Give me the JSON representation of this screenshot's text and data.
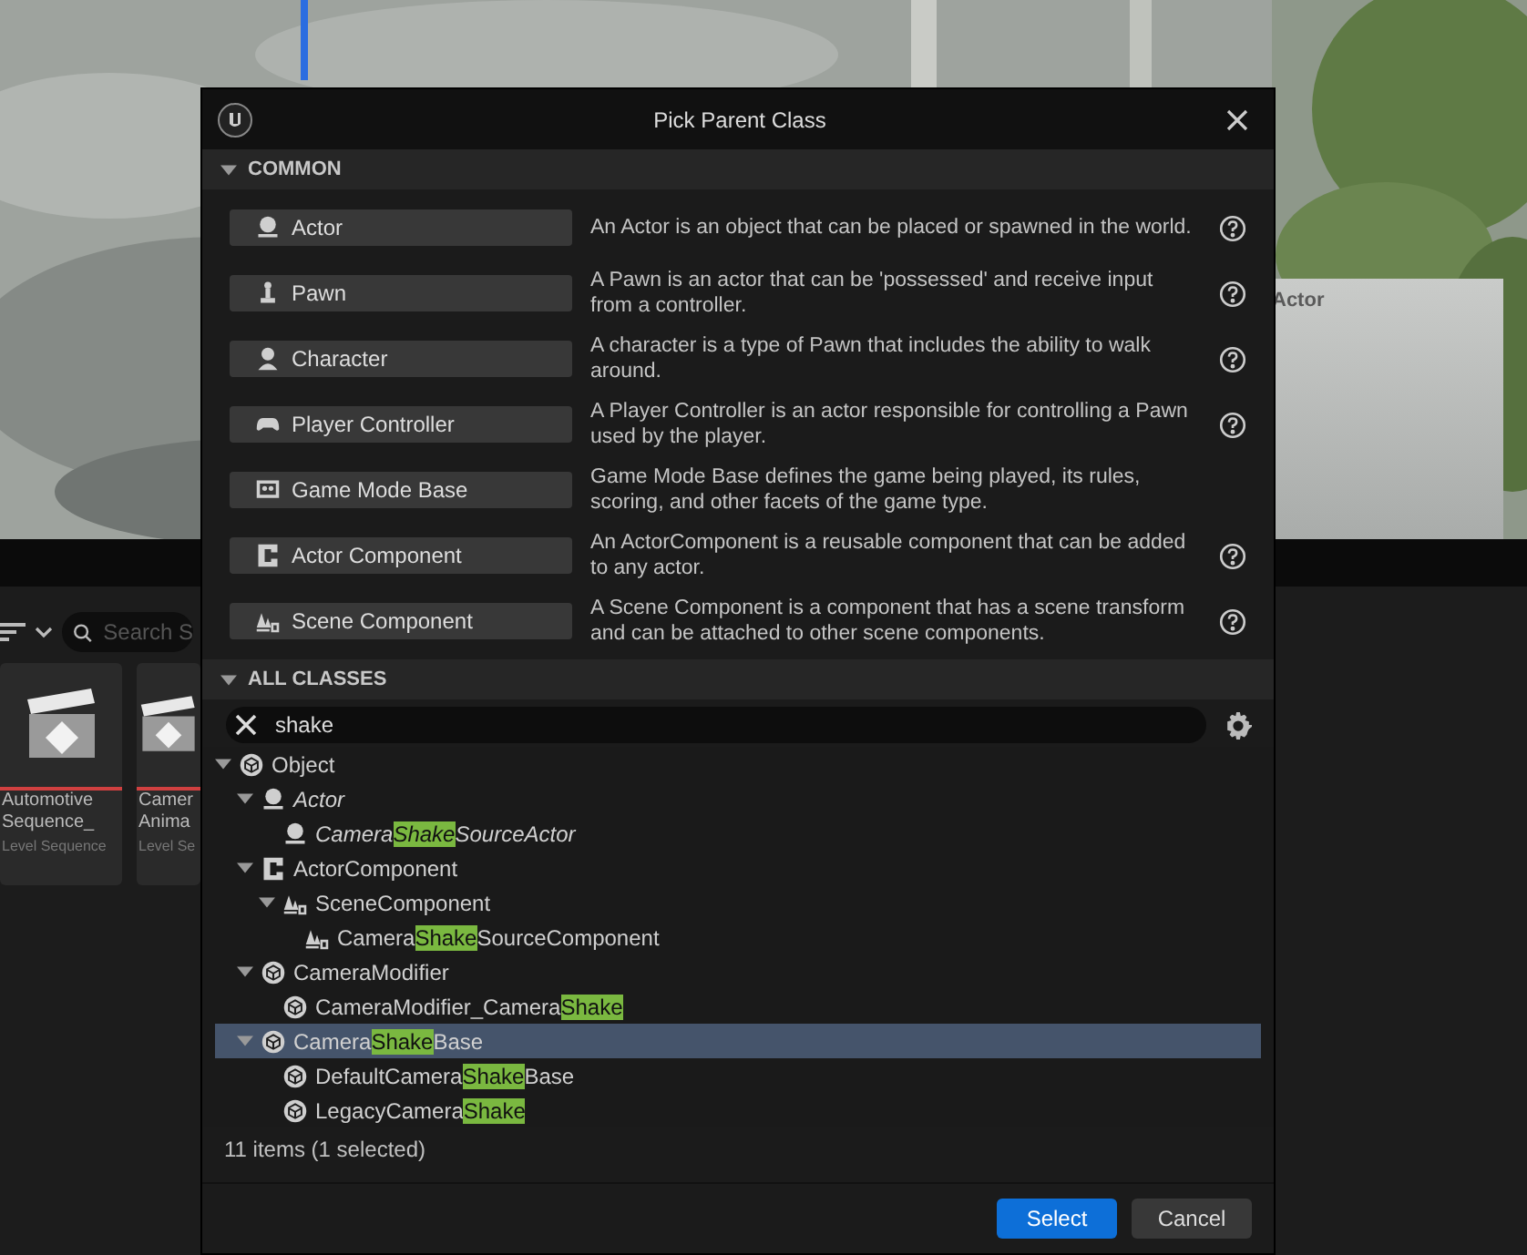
{
  "viewport": {
    "thumbnail_label": "Actor"
  },
  "content_browser": {
    "search": {
      "placeholder": "Search S"
    },
    "assets": [
      {
        "name_lines": [
          "Automotive",
          "Sequence_"
        ],
        "type": "Level Sequence"
      },
      {
        "name_lines": [
          "Camer",
          "Anima"
        ],
        "type": "Level Se"
      }
    ]
  },
  "dialog": {
    "title": "Pick Parent Class",
    "common": {
      "title": "COMMON",
      "expanded": true,
      "rows": [
        {
          "kind": "actor",
          "label": "Actor",
          "description": "An Actor is an object that can be placed or spawned in the world.",
          "help": true
        },
        {
          "kind": "pawn",
          "label": "Pawn",
          "description": "A Pawn is an actor that can be 'possessed' and receive input from a controller.",
          "help": true
        },
        {
          "kind": "character",
          "label": "Character",
          "description": "A character is a type of Pawn that includes the ability to walk around.",
          "help": true
        },
        {
          "kind": "controller",
          "label": "Player Controller",
          "description": "A Player Controller is an actor responsible for controlling a Pawn used by the player.",
          "help": true
        },
        {
          "kind": "gamemode",
          "label": "Game Mode Base",
          "description": "Game Mode Base defines the game being played, its rules, scoring, and other facets of the game type.",
          "help": false
        },
        {
          "kind": "component",
          "label": "Actor Component",
          "description": "An ActorComponent is a reusable component that can be added to any actor.",
          "help": true
        },
        {
          "kind": "scene",
          "label": "Scene Component",
          "description": "A Scene Component is a component that has a scene transform and can be attached to other scene components.",
          "help": true
        }
      ]
    },
    "all_classes": {
      "title": "ALL CLASSES",
      "expanded": true,
      "search": {
        "value": "shake"
      },
      "tree": [
        {
          "kind": "object",
          "italic": false,
          "selected": false,
          "expanded": true,
          "segments": [
            {
              "text": "Object",
              "match": false
            }
          ],
          "children": [
            {
              "kind": "actor",
              "italic": true,
              "selected": false,
              "expanded": true,
              "segments": [
                {
                  "text": "Actor",
                  "match": false
                }
              ],
              "children": [
                {
                  "kind": "actor",
                  "italic": true,
                  "selected": false,
                  "segments": [
                    {
                      "text": "Camera",
                      "match": false
                    },
                    {
                      "text": "Shake",
                      "match": true
                    },
                    {
                      "text": "SourceActor",
                      "match": false
                    }
                  ]
                }
              ]
            },
            {
              "kind": "component",
              "italic": false,
              "selected": false,
              "expanded": true,
              "segments": [
                {
                  "text": "ActorComponent",
                  "match": false
                }
              ],
              "children": [
                {
                  "kind": "scene",
                  "italic": false,
                  "selected": false,
                  "expanded": true,
                  "segments": [
                    {
                      "text": "SceneComponent",
                      "match": false
                    }
                  ],
                  "children": [
                    {
                      "kind": "scene",
                      "italic": false,
                      "selected": false,
                      "segments": [
                        {
                          "text": "Camera",
                          "match": false
                        },
                        {
                          "text": "Shake",
                          "match": true
                        },
                        {
                          "text": "SourceComponent",
                          "match": false
                        }
                      ]
                    }
                  ]
                }
              ]
            },
            {
              "kind": "object",
              "italic": false,
              "selected": false,
              "expanded": true,
              "segments": [
                {
                  "text": "CameraModifier",
                  "match": false
                }
              ],
              "children": [
                {
                  "kind": "object",
                  "italic": false,
                  "selected": false,
                  "segments": [
                    {
                      "text": "CameraModifier_Camera",
                      "match": false
                    },
                    {
                      "text": "Shake",
                      "match": true
                    }
                  ]
                }
              ]
            },
            {
              "kind": "object",
              "italic": false,
              "selected": true,
              "expanded": true,
              "segments": [
                {
                  "text": "Camera",
                  "match": false
                },
                {
                  "text": "Shake",
                  "match": true
                },
                {
                  "text": "Base",
                  "match": false
                }
              ],
              "children": [
                {
                  "kind": "object",
                  "italic": false,
                  "selected": false,
                  "segments": [
                    {
                      "text": "DefaultCamera",
                      "match": false
                    },
                    {
                      "text": "Shake",
                      "match": true
                    },
                    {
                      "text": "Base",
                      "match": false
                    }
                  ]
                },
                {
                  "kind": "object",
                  "italic": false,
                  "selected": false,
                  "segments": [
                    {
                      "text": "LegacyCamera",
                      "match": false
                    },
                    {
                      "text": "Shake",
                      "match": true
                    }
                  ]
                }
              ]
            }
          ]
        }
      ],
      "status": "11 items (1 selected)"
    },
    "buttons": [
      {
        "label": "Select",
        "primary": true
      },
      {
        "label": "Cancel",
        "primary": false
      }
    ]
  }
}
